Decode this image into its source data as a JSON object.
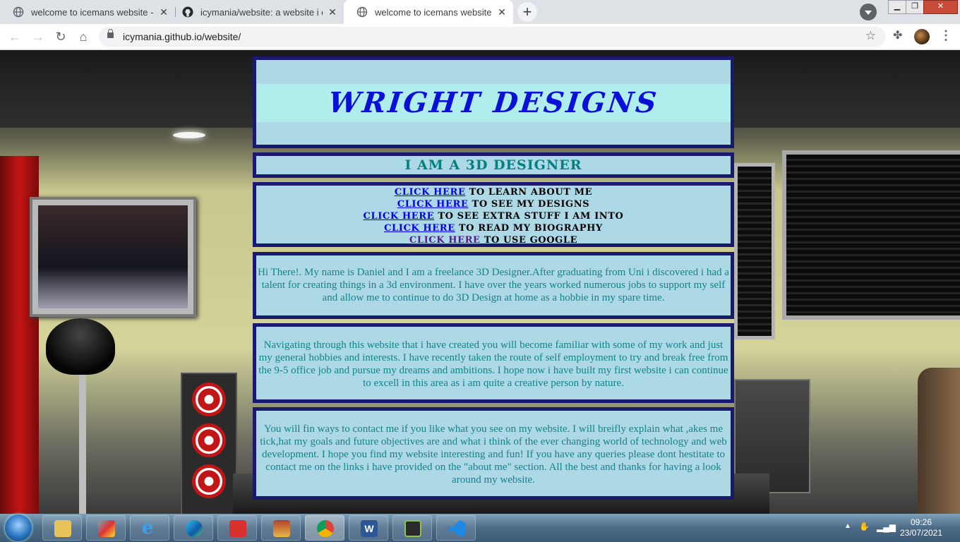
{
  "browser": {
    "tabs": [
      {
        "title": "welcome to icemans website - ic",
        "active": false,
        "favicon": "globe-icon"
      },
      {
        "title": "icymania/website: a website i de",
        "active": false,
        "favicon": "github-icon"
      },
      {
        "title": "welcome to icemans website - ic",
        "active": true,
        "favicon": "globe-icon"
      }
    ],
    "new_tab_label": "+",
    "url": "icymania.github.io/website/"
  },
  "site": {
    "title": "WRIGHT DESIGNS",
    "subtitle": "I AM A 3D DESIGNER",
    "links": [
      {
        "link_text": "CLICK HERE",
        "rest": "TO LEARN ABOUT ME"
      },
      {
        "link_text": "CLICK HERE",
        "rest": "TO SEE MY DESIGNS"
      },
      {
        "link_text": "CLICK HERE",
        "rest": "TO SEE EXTRA STUFF I AM INTO"
      },
      {
        "link_text": "CLICK HERE",
        "rest": "TO READ MY BIOGRAPHY"
      },
      {
        "link_text": "CLICK HERE",
        "rest": "TO USE GOOGLE"
      }
    ],
    "paragraphs": [
      "Hi There!. My name is Daniel and I am a freelance 3D Designer.After graduating from Uni i discovered i had a talent for creating things in a 3d environment. I have over the years worked numerous jobs to support my self and allow me to continue to do 3D Design at home as a hobbie in my spare time.",
      "Navigating through this website that i have created you will become familiar with some of my work and just my general hobbies and interests. I have recently taken the route of self employment to try and break free from the 9-5 office job and pursue my dreams and ambitions. I hope now i have built my first website i can continue to excell in this area as i am quite a creative person by nature.",
      "You will fin ways to contact me if you like what you see on my website. I will breifly explain what ,akes me tick,hat my goals and future objectives are and what i think of the ever changing world of technology and web development. I hope you find my website interesting and fun! If you have any queries please dont hestitate to contact me on the links i have provided on the \"about me\" section. All the best and thanks for having a look around my website."
    ]
  },
  "taskbar": {
    "time": "09:26",
    "date": "23/07/2021",
    "apps": [
      "file-explorer",
      "paint",
      "internet-explorer",
      "edge",
      "mp3-app",
      "winrar",
      "chrome",
      "word",
      "task-manager",
      "vscode"
    ]
  },
  "colors": {
    "panel_bg": "#add8e6",
    "panel_border": "#191970",
    "title_color": "#0b10d8",
    "subtitle_color": "#008080",
    "paragraph_color": "#138585"
  }
}
